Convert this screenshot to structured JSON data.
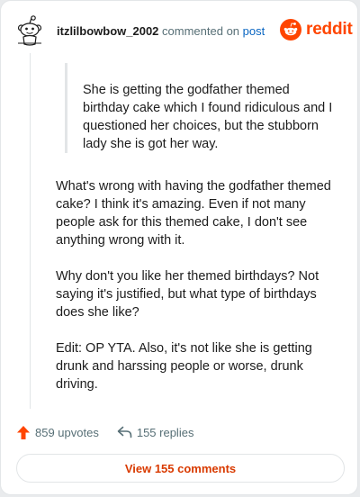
{
  "comment": {
    "username": "itzlilbowbow_2002",
    "action_text": "commented on",
    "post_link": "post",
    "quote": "She is getting the godfather themed birthday cake which I found ridiculous and I questioned her choices, but the stubborn lady she is got her way.",
    "paragraphs": [
      "What's wrong with having the godfather themed cake? I think it's amazing. Even if not many people ask for this themed cake, I don't see anything wrong with it.",
      "Why don't you like her themed birthdays? Not saying it's justified, but what type of birthdays does she like?",
      "Edit: OP YTA. Also, it's not like she is getting drunk and harssing people or worse, drunk driving."
    ]
  },
  "brand": {
    "name": "reddit",
    "color": "#ff4500"
  },
  "stats": {
    "upvotes": "859 upvotes",
    "replies": "155 replies",
    "upvote_icon": "upvote-arrow-icon",
    "reply_icon": "reply-arrow-icon"
  },
  "view_button": "View 155 comments"
}
